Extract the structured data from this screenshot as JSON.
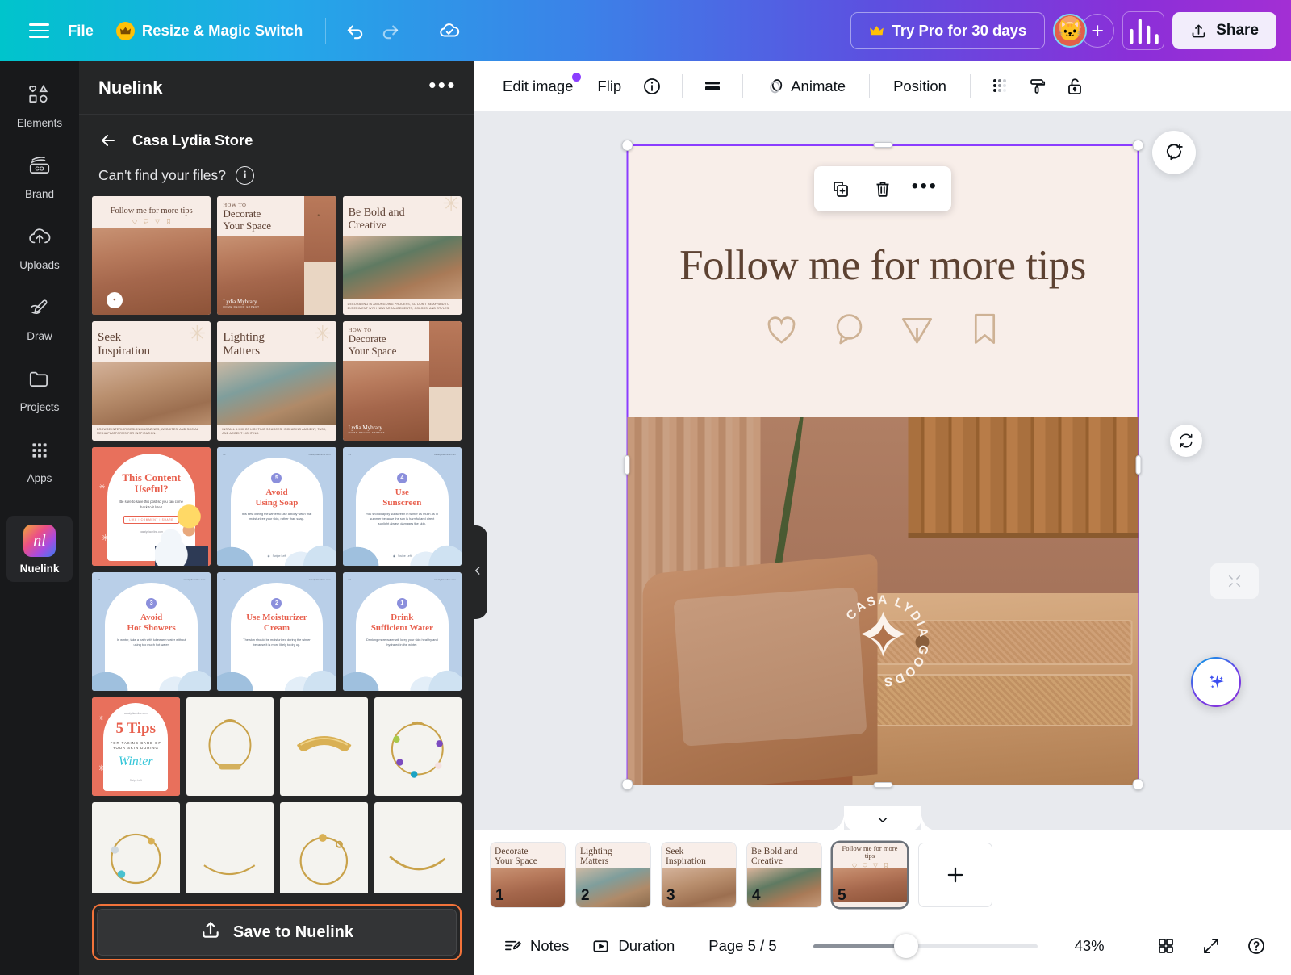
{
  "topbar": {
    "menu_icon": "hamburger-icon",
    "file_label": "File",
    "resize_label": "Resize & Magic Switch",
    "undo_icon": "undo-icon",
    "redo_icon": "redo-icon",
    "cloud_icon": "cloud-saved-icon",
    "try_pro_label": "Try Pro for 30 days",
    "avatar_label": "🐱",
    "add_member_label": "+",
    "insights_icon": "bar-chart-icon",
    "share_label": "Share"
  },
  "rail": {
    "items": [
      {
        "label": "Elements",
        "icon": "shapes-icon"
      },
      {
        "label": "Brand",
        "icon": "brand-icon"
      },
      {
        "label": "Uploads",
        "icon": "cloud-upload-icon"
      },
      {
        "label": "Draw",
        "icon": "pen-icon"
      },
      {
        "label": "Projects",
        "icon": "folder-icon"
      },
      {
        "label": "Apps",
        "icon": "grid-dots-icon"
      }
    ],
    "active_app": {
      "label": "Nuelink",
      "logo_text": "nl"
    }
  },
  "panel": {
    "title": "Nuelink",
    "more_icon": "ellipsis-icon",
    "back_icon": "arrow-left-icon",
    "store_name": "Casa Lydia Store",
    "cant_find_label": "Can't find your files?",
    "info_icon": "info-icon",
    "save_button_label": "Save to Nuelink",
    "save_button_icon": "upload-icon",
    "collapse_icon": "chevron-left-icon",
    "assets": [
      {
        "type": "interior",
        "kicker": "",
        "title": "Follow me for more tips",
        "variant": "follow",
        "caption": ""
      },
      {
        "type": "interior",
        "kicker": "HOW TO",
        "title": "Decorate\nYour Space",
        "variant": "howto",
        "caption": "",
        "signature": "Lydia Mybrary",
        "signature_sub": "HOME DECOR EXPERT"
      },
      {
        "type": "interior",
        "kicker": "",
        "title": "Be Bold and\nCreative",
        "variant": "kitchen",
        "caption": "DECORATING IS AN ONGOING PROCESS, SO DON'T BE AFRAID TO EXPERIMENT WITH NEW ARRANGEMENTS, COLORS, AND STYLES."
      },
      {
        "type": "interior",
        "kicker": "",
        "title": "Seek\nInspiration",
        "variant": "dining",
        "caption": "BROWSE INTERIOR DESIGN MAGAZINES, WEBSITES, AND SOCIAL MEDIA PLATFORMS FOR INSPIRATION."
      },
      {
        "type": "interior",
        "kicker": "",
        "title": "Lighting\nMatters",
        "variant": "lighting",
        "caption": "INSTALL A MIX OF LIGHTING SOURCES, INCLUDING AMBIENT, TASK, AND ACCENT LIGHTING."
      },
      {
        "type": "interior",
        "kicker": "HOW TO",
        "title": "Decorate\nYour Space",
        "variant": "howto",
        "caption": "",
        "signature": "Lydia Mybrary",
        "signature_sub": "HOME DECOR EXPERT"
      },
      {
        "type": "coral",
        "title": "This Content\nUseful?",
        "body": "Be sure to save this post so you can come back to it later!",
        "pill": "LIKE | COMMENT | SHARE",
        "site": "casalydiaonline.com"
      },
      {
        "type": "winter",
        "number": "5",
        "title": "Avoid\nUsing Soap",
        "body": "It is best during the winter to use a body wash that moisturizes your skin, rather than soap.",
        "swipe": "Swipe Left",
        "site": "casalydiaonline.com"
      },
      {
        "type": "winter",
        "number": "4",
        "title": "Use\nSunscreen",
        "body": "You should apply sunscreen in winter as much as in summer because the sun is harmful and direct sunlight always damages the skin.",
        "swipe": "Swipe Left",
        "site": "casalydiaonline.com"
      },
      {
        "type": "winter",
        "number": "3",
        "title": "Avoid\nHot Showers",
        "body": "In winter, take a bath with lukewarm water without using too much hot water.",
        "swipe": "Swipe Left",
        "site": "casalydiaonline.com"
      },
      {
        "type": "winter",
        "number": "2",
        "title": "Use Moisturizer\nCream",
        "body": "The skin should be moisturized during the winter because it is more likely to dry up.",
        "swipe": "Swipe Left",
        "site": "casalydiaonline.com"
      },
      {
        "type": "winter",
        "number": "1",
        "title": "Drink\nSufficient Water",
        "body": "Drinking more water will keep your skin healthy and hydrated in the winter.",
        "swipe": "Swipe Left",
        "site": "casalydiaonline.com"
      }
    ],
    "assets_row5": [
      {
        "type": "coral-tips",
        "title": "5 Tips",
        "sub": "FOR TAKING CARE OF\nYOUR SKIN DURING",
        "script": "Winter",
        "swipe": "Swipe Left"
      },
      {
        "type": "jewelry",
        "variant": "bar-necklace"
      },
      {
        "type": "jewelry",
        "variant": "gold-cuff"
      },
      {
        "type": "jewelry",
        "variant": "gemstone-bracelet"
      }
    ],
    "assets_row6": [
      {
        "type": "jewelry",
        "variant": "beaded-bracelet"
      },
      {
        "type": "jewelry",
        "variant": "thin-chain"
      },
      {
        "type": "jewelry",
        "variant": "charm-bracelet"
      },
      {
        "type": "jewelry",
        "variant": "link-bracelet"
      }
    ]
  },
  "editor_toolbar": {
    "edit_image_label": "Edit image",
    "edit_image_has_badge": true,
    "flip_label": "Flip",
    "info_icon": "info-icon",
    "layers_icon": "layers-icon",
    "animate_label": "Animate",
    "animate_icon": "animate-icon",
    "position_label": "Position",
    "transparency_icon": "transparency-icon",
    "roller_icon": "paint-roller-icon",
    "lock_icon": "unlock-icon"
  },
  "float_tools": {
    "duplicate_icon": "duplicate-icon",
    "delete_icon": "trash-icon",
    "more_icon": "ellipsis-icon"
  },
  "canvas": {
    "headline": "Follow me for more tips",
    "ig_icons": [
      "heart-icon",
      "comment-icon",
      "send-icon",
      "bookmark-icon"
    ],
    "watermark_text": "CASA LYDIA GOODS",
    "selection_color": "#8b3dff",
    "comment_icon": "add-comment-icon",
    "replace_icon": "refresh-icon",
    "magic_icon": "magic-sparkle-icon"
  },
  "pages": {
    "collapse_icon": "chevron-down-icon",
    "add_icon": "plus-icon",
    "items": [
      {
        "number": "1",
        "title": "Decorate\nYour Space",
        "variant": "howto",
        "selected": false
      },
      {
        "number": "2",
        "title": "Lighting\nMatters",
        "variant": "lighting",
        "selected": false
      },
      {
        "number": "3",
        "title": "Seek\nInspiration",
        "variant": "dining",
        "selected": false
      },
      {
        "number": "4",
        "title": "Be Bold and\nCreative",
        "variant": "kitchen",
        "selected": false
      },
      {
        "number": "5",
        "title": "Follow me for more tips",
        "variant": "follow",
        "selected": true
      }
    ]
  },
  "status": {
    "notes_label": "Notes",
    "notes_icon": "notes-icon",
    "duration_label": "Duration",
    "duration_icon": "duration-icon",
    "page_label": "Page 5 / 5",
    "zoom_label": "43%",
    "zoom_percent": 43,
    "grid_icon": "grid-view-icon",
    "fullscreen_icon": "expand-icon",
    "help_icon": "help-icon"
  }
}
